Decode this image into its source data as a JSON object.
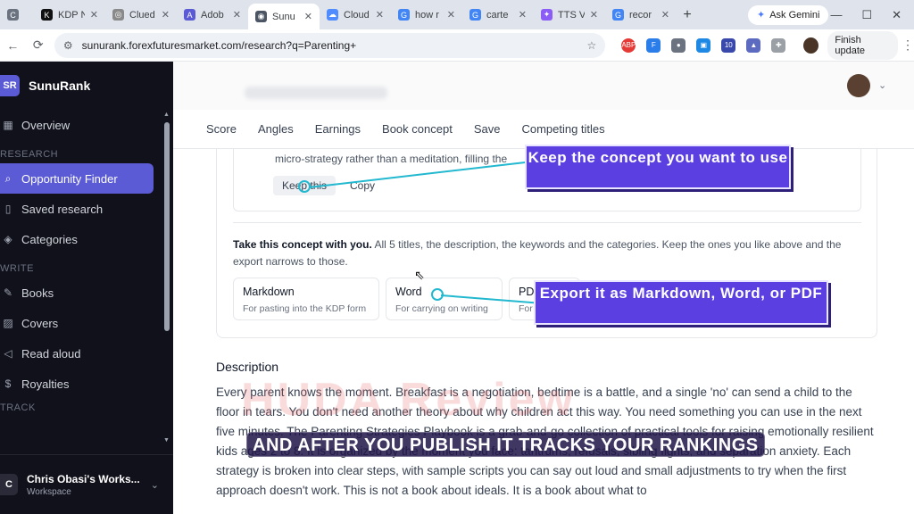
{
  "browser": {
    "tabs": [
      {
        "title": "",
        "fav": "C",
        "color": "#6b7280"
      },
      {
        "title": "KDP N",
        "fav": "K",
        "color": "#111111"
      },
      {
        "title": "Clued",
        "fav": "◎",
        "color": "#8a8a8a"
      },
      {
        "title": "Adob",
        "fav": "A",
        "color": "#5b5bd6"
      },
      {
        "title": "Sunu",
        "fav": "◉",
        "color": "#4b5563"
      },
      {
        "title": "Cloud",
        "fav": "☁",
        "color": "#4f8cff"
      },
      {
        "title": "how r",
        "fav": "G",
        "color": "#4285f4"
      },
      {
        "title": "carte",
        "fav": "G",
        "color": "#4285f4"
      },
      {
        "title": "TTS V",
        "fav": "✦",
        "color": "#8b5cf6"
      },
      {
        "title": "recor",
        "fav": "G",
        "color": "#4285f4"
      }
    ],
    "new_tab": "+",
    "gemini": "Ask Gemini",
    "url": "sunurank.forexfuturesmarket.com/research?q=Parenting+",
    "finish_update": "Finish update"
  },
  "sidebar": {
    "logo": "SR",
    "brand": "SunuRank",
    "overview": "Overview",
    "research_header": "RESEARCH",
    "research_items": [
      "Opportunity Finder",
      "Saved research",
      "Categories"
    ],
    "write_header": "WRITE",
    "write_items": [
      "Books",
      "Covers",
      "Read aloud",
      "Royalties"
    ],
    "track_header": "TRACK",
    "workspace_initial": "C",
    "workspace_name": "Chris Obasi's Works...",
    "workspace_sub": "Workspace"
  },
  "subtabs": [
    "Score",
    "Angles",
    "Earnings",
    "Book concept",
    "Save",
    "Competing titles"
  ],
  "concept": {
    "fragment": "micro-strategy rather than a meditation, filling the",
    "keep": "Keep this",
    "copy": "Copy"
  },
  "export": {
    "title": "Take this concept with you.",
    "text": " All 5 titles, the description, the keywords and the categories. Keep the ones you like above and the export narrows to those.",
    "options": [
      {
        "title": "Markdown",
        "desc": "For pasting into the KDP form"
      },
      {
        "title": "Word",
        "desc": "For carrying on writing"
      },
      {
        "title": "PD",
        "desc": "For"
      }
    ]
  },
  "description": {
    "heading": "Description",
    "body": "Every parent knows the moment. Breakfast is a negotiation, bedtime is a battle, and a single 'no' can send a child to the floor in tears. You don't need another theory about why children act this way. You need something you can use in the next five minutes. The Parenting Strategies Playbook is a grab-and-go collection of practical tools for raising emotionally resilient kids ages 2 to 8. It is organized by the moment you face: tantrums, refusals, sibling fights, and separation anxiety. Each strategy is broken into clear steps, with sample scripts you can say out loud and small adjustments to try when the first approach doesn't work. This is not a book about ideals. It is a book about what to"
  },
  "overlays": {
    "callout1": "Keep the concept you want to use",
    "callout2": "Export it as Markdown, Word, or PDF",
    "watermark": "HUDA Review",
    "caption": "AND AFTER YOU PUBLISH IT TRACKS YOUR RANKINGS"
  }
}
